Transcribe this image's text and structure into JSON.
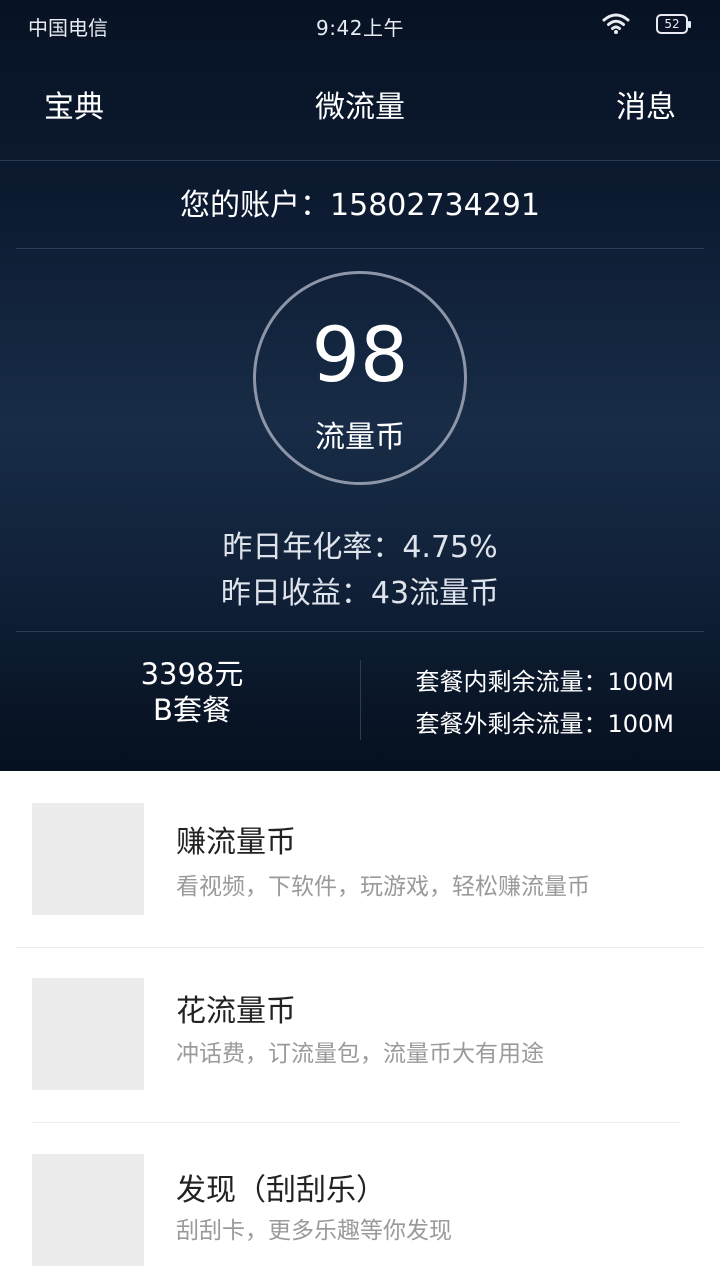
{
  "status_bar": {
    "carrier": "中国电信",
    "time": "9:42上午",
    "battery": "52",
    "wifi_icon": "wifi-icon"
  },
  "nav": {
    "left": "宝典",
    "title": "微流量",
    "right": "消息"
  },
  "account": {
    "text": "您的账户：15802734291"
  },
  "coins": {
    "value": "98",
    "unit": "流量币"
  },
  "stats": {
    "rate": "昨日年化率：4.75%",
    "income": "昨日收益：43流量币"
  },
  "plan": {
    "price": "3398元",
    "name": "B套餐",
    "remaining_in": "套餐内剩余流量：100M",
    "remaining_out": "套餐外剩余流量：100M"
  },
  "list": [
    {
      "title": "赚流量币",
      "desc": "看视频，下软件，玩游戏，轻松赚流量币"
    },
    {
      "title": "花流量币",
      "desc": "冲话费，订流量包，流量币大有用途"
    },
    {
      "title": "发现（刮刮乐）",
      "desc": "刮刮卡，更多乐趣等你发现"
    }
  ],
  "colors": {
    "hero_top": "#071224",
    "hero_mid": "#182c47",
    "thumb_placeholder": "#ececec",
    "desc_gray": "#9a9a9a"
  }
}
